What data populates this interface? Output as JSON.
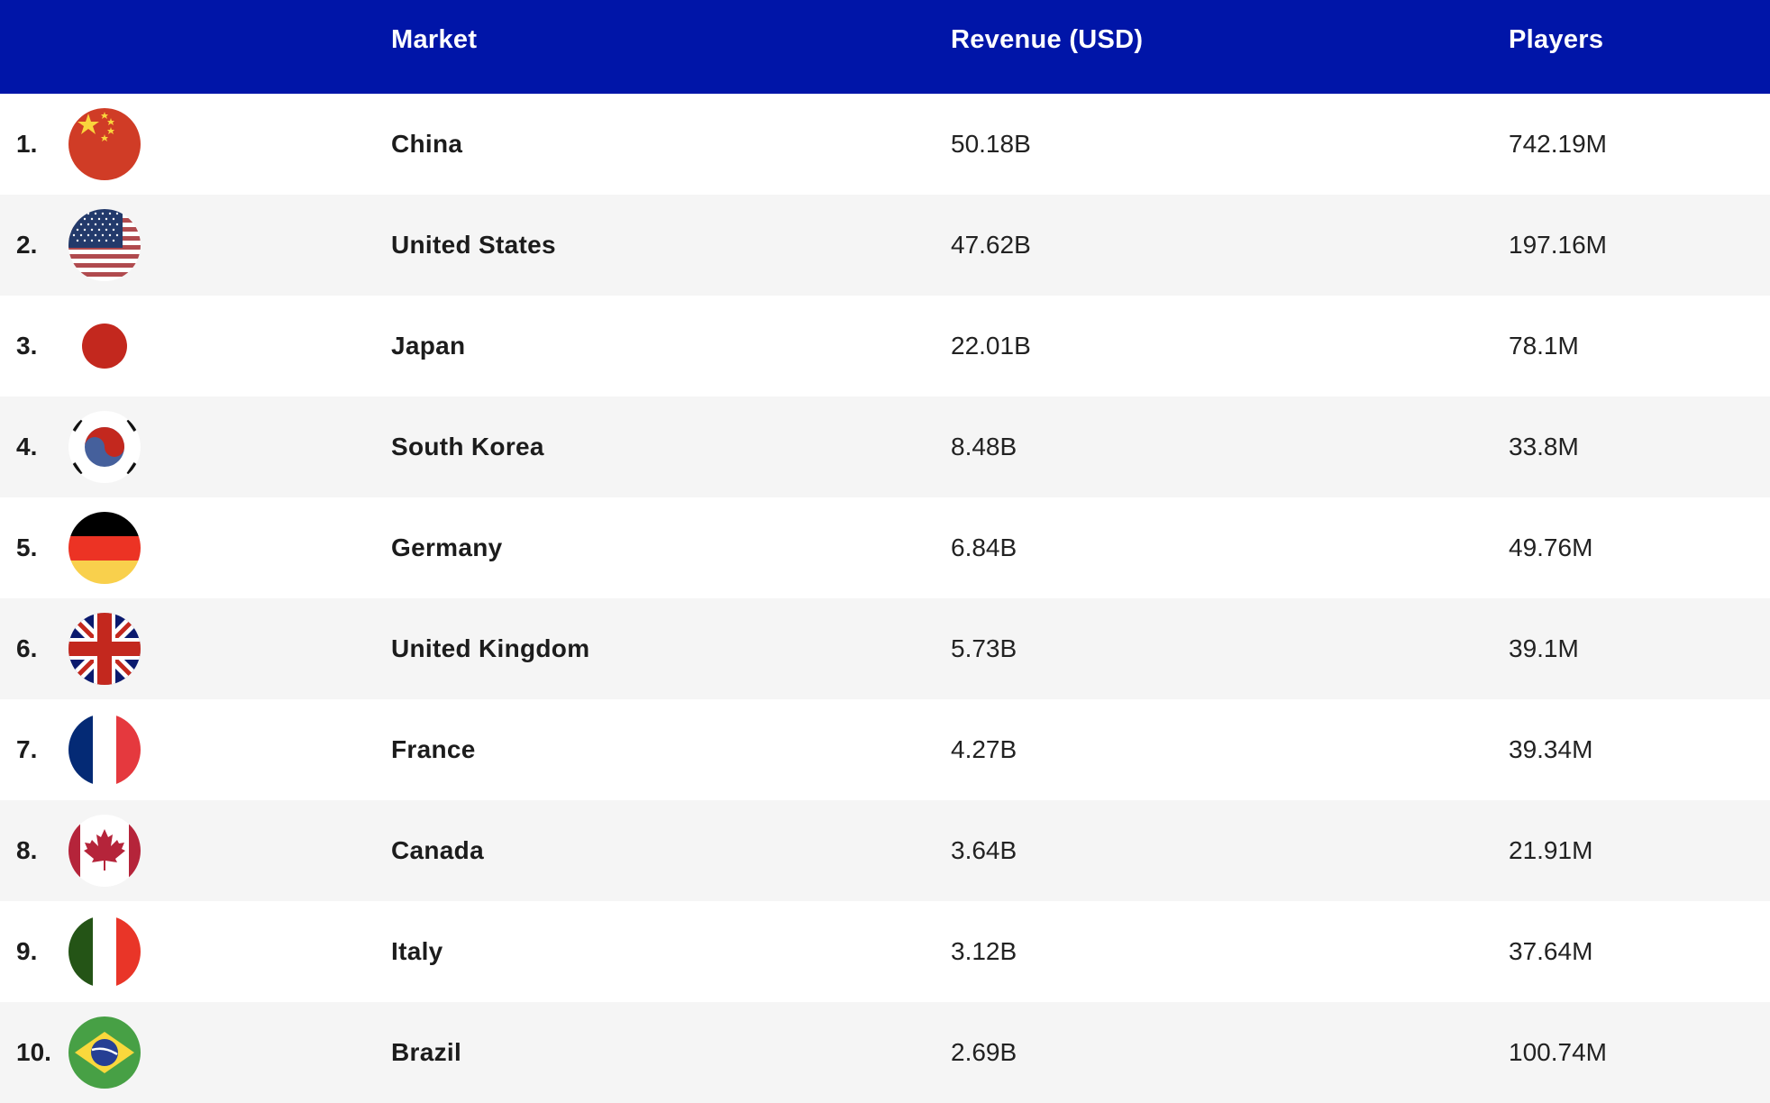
{
  "colors": {
    "header_bg": "#0015a8",
    "header_text": "#ffffff",
    "row_alt_bg": "#f5f5f5"
  },
  "table": {
    "headers": {
      "rank": "",
      "market": "Market",
      "revenue": "Revenue (USD)",
      "players": "Players"
    },
    "rows": [
      {
        "rank": "1.",
        "flag": "china-flag-icon",
        "market": "China",
        "revenue": "50.18B",
        "players": "742.19M"
      },
      {
        "rank": "2.",
        "flag": "usa-flag-icon",
        "market": "United States",
        "revenue": "47.62B",
        "players": "197.16M"
      },
      {
        "rank": "3.",
        "flag": "japan-flag-icon",
        "market": "Japan",
        "revenue": "22.01B",
        "players": "78.1M"
      },
      {
        "rank": "4.",
        "flag": "south-korea-flag-icon",
        "market": "South Korea",
        "revenue": "8.48B",
        "players": "33.8M"
      },
      {
        "rank": "5.",
        "flag": "germany-flag-icon",
        "market": "Germany",
        "revenue": "6.84B",
        "players": "49.76M"
      },
      {
        "rank": "6.",
        "flag": "uk-flag-icon",
        "market": "United Kingdom",
        "revenue": "5.73B",
        "players": "39.1M"
      },
      {
        "rank": "7.",
        "flag": "france-flag-icon",
        "market": "France",
        "revenue": "4.27B",
        "players": "39.34M"
      },
      {
        "rank": "8.",
        "flag": "canada-flag-icon",
        "market": "Canada",
        "revenue": "3.64B",
        "players": "21.91M"
      },
      {
        "rank": "9.",
        "flag": "italy-flag-icon",
        "market": "Italy",
        "revenue": "3.12B",
        "players": "37.64M"
      },
      {
        "rank": "10.",
        "flag": "brazil-flag-icon",
        "market": "Brazil",
        "revenue": "2.69B",
        "players": "100.74M"
      }
    ]
  }
}
